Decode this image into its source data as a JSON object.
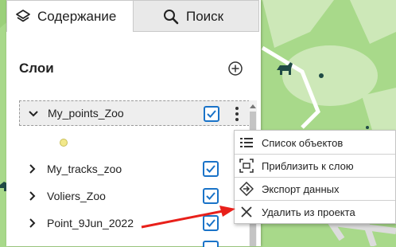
{
  "tabs": [
    {
      "label": "Содержание",
      "icon": "layers-icon",
      "active": true
    },
    {
      "label": "Поиск",
      "icon": "search-icon",
      "active": false
    }
  ],
  "layers": {
    "title": "Слои",
    "add_icon": "add-circle-icon",
    "items": [
      {
        "name": "My_points_Zoo",
        "expanded": true,
        "checked": true,
        "legend_color": "#f2e88a"
      },
      {
        "name": "My_tracks_zoo",
        "expanded": false,
        "checked": true
      },
      {
        "name": "Voliers_Zoo",
        "expanded": false,
        "checked": true
      },
      {
        "name": "Point_9Jun_2022",
        "expanded": false,
        "checked": true
      }
    ]
  },
  "context_menu": {
    "items": [
      {
        "label": "Список объектов",
        "icon": "list-icon"
      },
      {
        "label": "Приблизить к слою",
        "icon": "zoom-to-layer-icon"
      },
      {
        "label": "Экспорт данных",
        "icon": "export-icon"
      },
      {
        "label": "Удалить из проекта",
        "icon": "close-icon"
      }
    ]
  },
  "colors": {
    "accent": "#1a73c8",
    "map_green": "#a8d98a",
    "annotation_arrow": "#e8201a"
  }
}
